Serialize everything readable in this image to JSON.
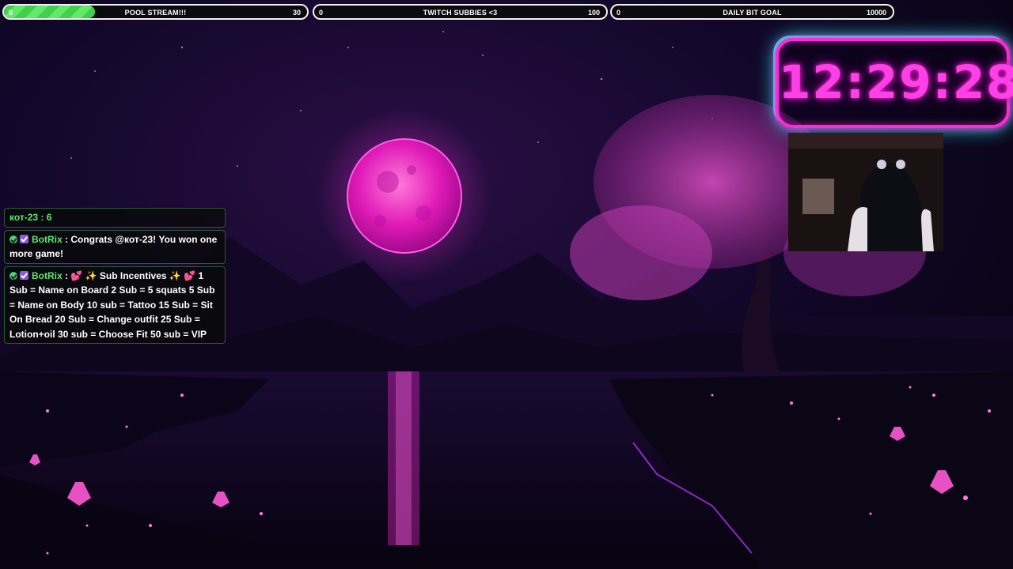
{
  "goals": [
    {
      "current": "9",
      "title": "POOL STREAM!!!",
      "target": "30",
      "progress": 0.3
    },
    {
      "current": "0",
      "title": "TWITCH SUBBIES <3",
      "target": "100",
      "progress": 0
    },
    {
      "current": "0",
      "title": "DAILY BIT GOAL",
      "target": "10000",
      "progress": 0
    }
  ],
  "clock": {
    "time": "12:29:28"
  },
  "chat": {
    "counter": "кот-23 : 6",
    "messages": [
      {
        "user": "BotRix",
        "text": " : Congrats @кот-23! You won one more game!"
      },
      {
        "user": "BotRix",
        "text": " : 💕 ✨ Sub Incentives ✨ 💕 1 Sub = Name on Board 2 Sub = 5 squats 5 Sub = Name on Body 10 sub = Tattoo 15 Sub = Sit On Bread 20 Sub = Change outfit 25 Sub = Lotion+oil 30 sub = Choose Fit 50 sub = VIP"
      }
    ]
  },
  "colors": {
    "accent_pink": "#ff2bd9",
    "accent_cyan": "#22e6e6",
    "goal_green": "#3fd14b",
    "chat_user": "#5ee96b"
  }
}
